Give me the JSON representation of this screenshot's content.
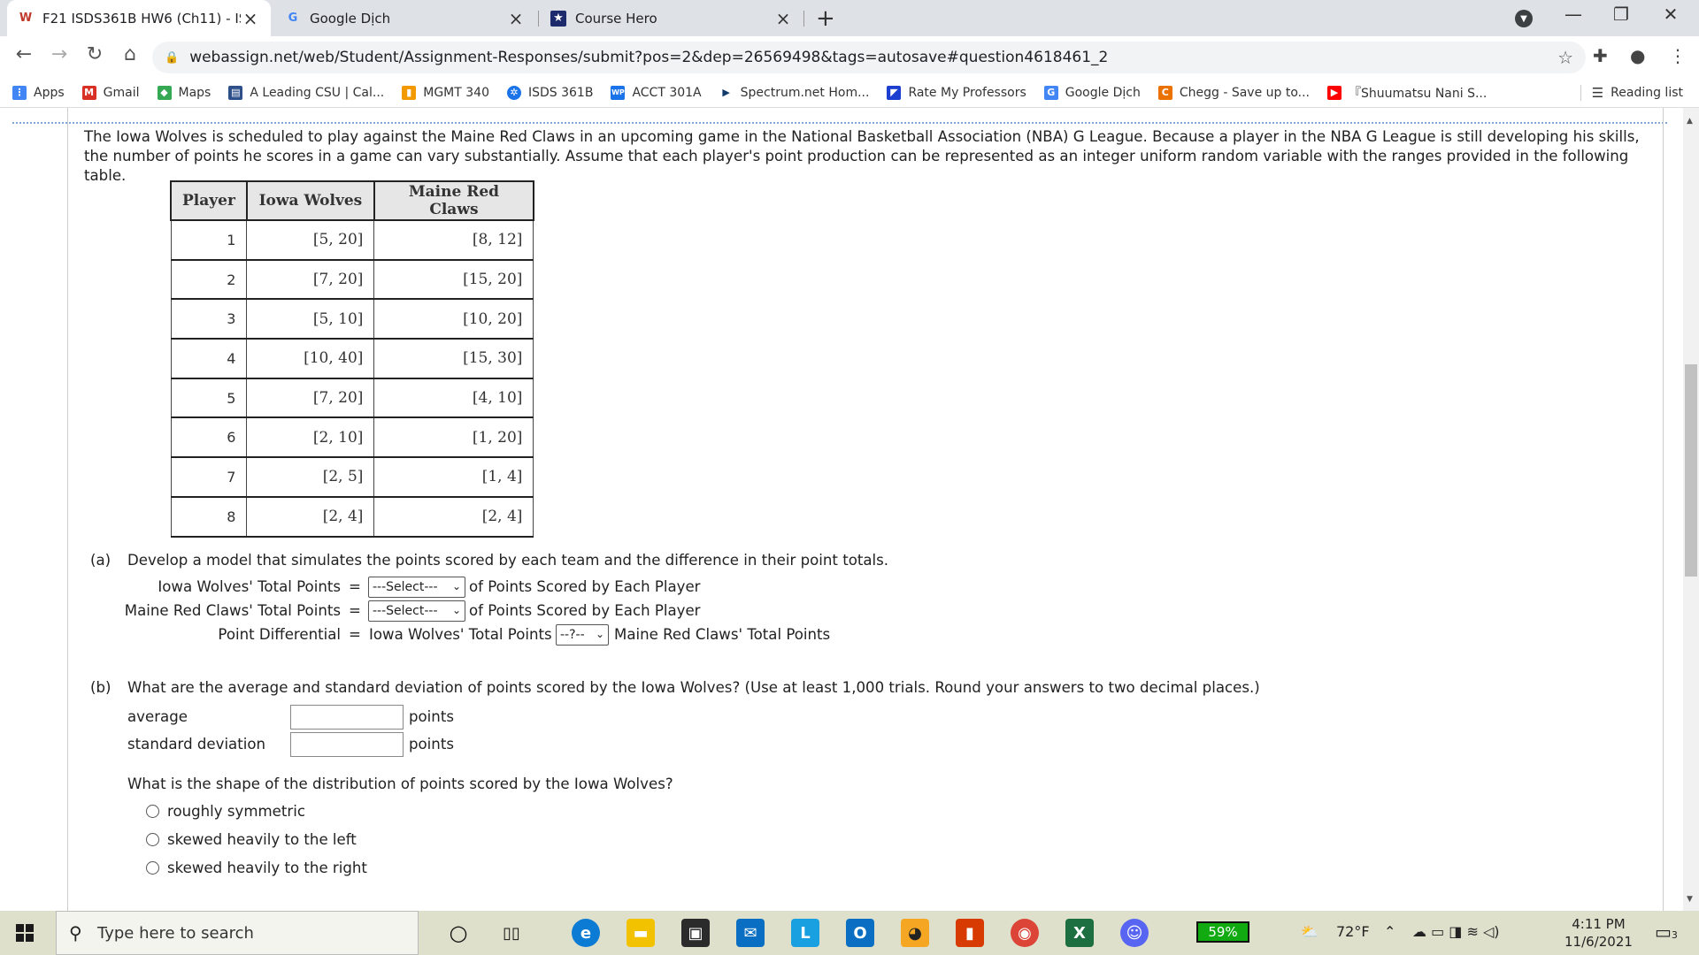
{
  "browser": {
    "tabs": [
      {
        "title": "F21 ISDS361B HW6 (Ch11) - ISDS",
        "icon": "webassign-icon"
      },
      {
        "title": "Google Dịch",
        "icon": "google-translate-icon"
      },
      {
        "title": "Course Hero",
        "icon": "coursehero-icon"
      }
    ],
    "new_tab": "+",
    "url": "webassign.net/web/Student/Assignment-Responses/submit?pos=2&dep=26569498&tags=autosave#question4618461_2"
  },
  "bookmarks": [
    {
      "label": "Apps",
      "icon": "apps-grid-icon",
      "color": "#4285f4"
    },
    {
      "label": "Gmail",
      "icon": "gmail-icon",
      "color": "#d93025"
    },
    {
      "label": "Maps",
      "icon": "maps-icon",
      "color": "#34a853"
    },
    {
      "label": "A Leading CSU | Cal...",
      "icon": "csu-icon",
      "color": "#2d4f8a"
    },
    {
      "label": "MGMT 340",
      "icon": "mgmt-icon",
      "color": "#f29900"
    },
    {
      "label": "ISDS 361B",
      "icon": "isds-icon",
      "color": "#1a73e8"
    },
    {
      "label": "ACCT 301A",
      "icon": "wp-icon",
      "color": "#1a73e8"
    },
    {
      "label": "Spectrum.net Hom...",
      "icon": "spectrum-icon",
      "color": "#123a6b"
    },
    {
      "label": "Rate My Professors",
      "icon": "rmp-icon",
      "color": "#1d3fd1"
    },
    {
      "label": "Google Dịch",
      "icon": "google-translate-icon",
      "color": "#4285f4"
    },
    {
      "label": "Chegg - Save up to...",
      "icon": "chegg-icon",
      "color": "#eb7100"
    },
    {
      "label": "『Shuumatsu Nani S...",
      "icon": "youtube-icon",
      "color": "#ff0000"
    }
  ],
  "reading_list": "Reading list",
  "question": {
    "intro": "The Iowa Wolves is scheduled to play against the Maine Red Claws in an upcoming game in the National Basketball Association (NBA) G League. Because a player in the NBA G League is still developing his skills, the number of points he scores in a game can vary substantially. Assume that each player's point production can be represented as an integer uniform random variable with the ranges provided in the following table.",
    "table": {
      "headers": [
        "Player",
        "Iowa Wolves",
        "Maine Red Claws"
      ],
      "rows": [
        [
          "1",
          "[5, 20]",
          "[8, 12]"
        ],
        [
          "2",
          "[7, 20]",
          "[15, 20]"
        ],
        [
          "3",
          "[5, 10]",
          "[10, 20]"
        ],
        [
          "4",
          "[10, 40]",
          "[15, 30]"
        ],
        [
          "5",
          "[7, 20]",
          "[4, 10]"
        ],
        [
          "6",
          "[2, 10]",
          "[1, 20]"
        ],
        [
          "7",
          "[2, 5]",
          "[1, 4]"
        ],
        [
          "8",
          "[2, 4]",
          "[2, 4]"
        ]
      ]
    },
    "part_a": {
      "label": "(a)",
      "text": "Develop a model that simulates the points scored by each team and the difference in their point totals.",
      "row1_label": "Iowa Wolves' Total Points",
      "row2_label": "Maine Red Claws' Total Points",
      "row3_label": "Point Differential",
      "equals": "=",
      "select_placeholder": "---Select---",
      "op_placeholder": "--?--",
      "suffix": "of Points Scored by Each Player",
      "row3_left": "Iowa Wolves' Total Points",
      "row3_right": "Maine Red Claws' Total Points"
    },
    "part_b": {
      "label": "(b)",
      "text": "What are the average and standard deviation of points scored by the Iowa Wolves? (Use at least 1,000 trials. Round your answers to two decimal places.)",
      "average_label": "average",
      "std_label": "standard deviation",
      "unit": "points",
      "shape_question": "What is the shape of the distribution of points scored by the Iowa Wolves?",
      "options": [
        "roughly symmetric",
        "skewed heavily to the left",
        "skewed heavily to the right"
      ]
    }
  },
  "taskbar": {
    "search_placeholder": "Type here to search",
    "battery": "59%",
    "temperature": "72°F",
    "time": "4:11 PM",
    "date": "11/6/2021",
    "notifications": "3"
  }
}
